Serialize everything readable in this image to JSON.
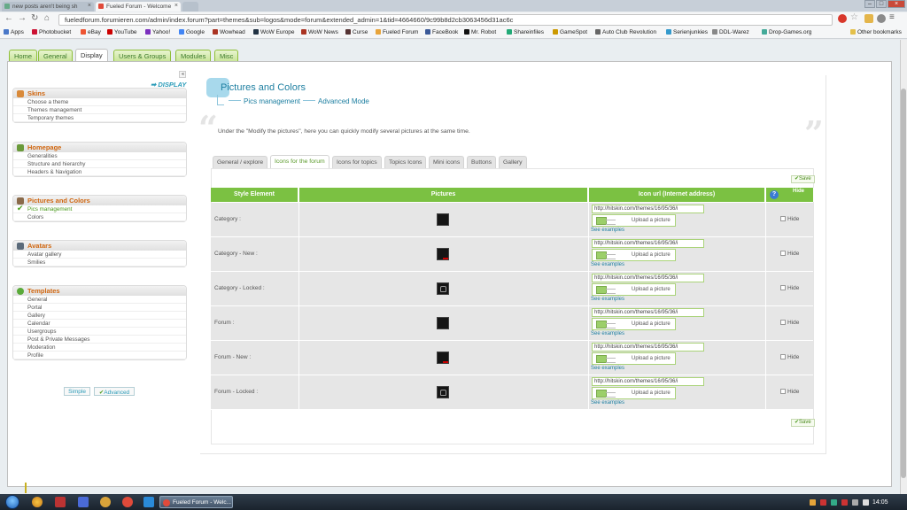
{
  "browser": {
    "tabs": [
      {
        "label": "new posts aren't being sh",
        "active": false
      },
      {
        "label": "Fueled Forum - Welcome",
        "active": true
      }
    ],
    "url": "fueledforum.forumieren.com/admin/index.forum?part=themes&sub=logos&mode=forum&extended_admin=1&tid=4664660/9c99b8d2cb3063456d31ac6c",
    "bookmarks": [
      "Apps",
      "Photobucket",
      "eBay",
      "YouTube",
      "Yahoo!",
      "Google",
      "Wowhead",
      "WoW Europe",
      "WoW News",
      "Curse",
      "Fueled Forum",
      "FaceBook",
      "Mr. Robot",
      "Shareinfiles",
      "GameSpot",
      "Auto Club Revolution",
      "Serienjunkies",
      "DDL-Warez",
      "Drop-Games.org"
    ],
    "other_bookmarks": "Other bookmarks"
  },
  "admin_tabs": [
    "Home",
    "General",
    "Display",
    "Users & Groups",
    "Modules",
    "Misc"
  ],
  "sidebar": {
    "display_link": "➡ DISPLAY",
    "sections": [
      {
        "title": "Skins",
        "items": [
          "Choose a theme",
          "Themes management",
          "Temporary themes"
        ]
      },
      {
        "title": "Homepage",
        "items": [
          "Generalities",
          "Structure and hierarchy",
          "Headers & Navigation"
        ]
      },
      {
        "title": "Pictures and Colors",
        "items": [
          "Pics management",
          "Colors"
        ]
      },
      {
        "title": "Avatars",
        "items": [
          "Avatar gallery",
          "Smilies"
        ]
      },
      {
        "title": "Templates",
        "items": [
          "General",
          "Portal",
          "Gallery",
          "Calendar",
          "Usergroups",
          "Post & Private Messages",
          "Moderation",
          "Profile"
        ]
      }
    ],
    "mode_simple": "Simple",
    "mode_advanced": "Advanced"
  },
  "main": {
    "title": "Pictures and Colors",
    "breadcrumb_1": "Pics management",
    "breadcrumb_2": "Advanced Mode",
    "intro": "Under the \"Modify the pictures\", here you can quickly modify several pictures at the same time.",
    "subtabs": [
      "General / explore",
      "Icons for the forum",
      "Icons for topics",
      "Topics Icons",
      "Mini icons",
      "Buttons",
      "Gallery"
    ],
    "save_label": "Save",
    "columns": [
      "Style Element",
      "Pictures",
      "Icon url (Internet address)",
      "Hide"
    ],
    "rows": [
      {
        "name": "Category :",
        "url": "http://hitskin.com/themes/16/95/36/i",
        "variant": "plain"
      },
      {
        "name": "Category - New :",
        "url": "http://hitskin.com/themes/16/95/36/i",
        "variant": "new"
      },
      {
        "name": "Category - Locked :",
        "url": "http://hitskin.com/themes/16/95/36/i",
        "variant": "locked"
      },
      {
        "name": "Forum :",
        "url": "http://hitskin.com/themes/16/95/36/i",
        "variant": "plain"
      },
      {
        "name": "Forum - New :",
        "url": "http://hitskin.com/themes/16/95/36/i",
        "variant": "new"
      },
      {
        "name": "Forum - Locked :",
        "url": "http://hitskin.com/themes/16/95/36/i",
        "variant": "locked"
      }
    ],
    "upload_label": "Upload a picture",
    "see_examples": "See examples",
    "hide_label": "Hide"
  },
  "taskbar": {
    "app_label": "Fueled Forum - Welc...",
    "clock": "14:05"
  },
  "colors": {
    "accent_green": "#7bc142",
    "link_blue": "#1e7fa1",
    "section_orange": "#d0660f"
  }
}
